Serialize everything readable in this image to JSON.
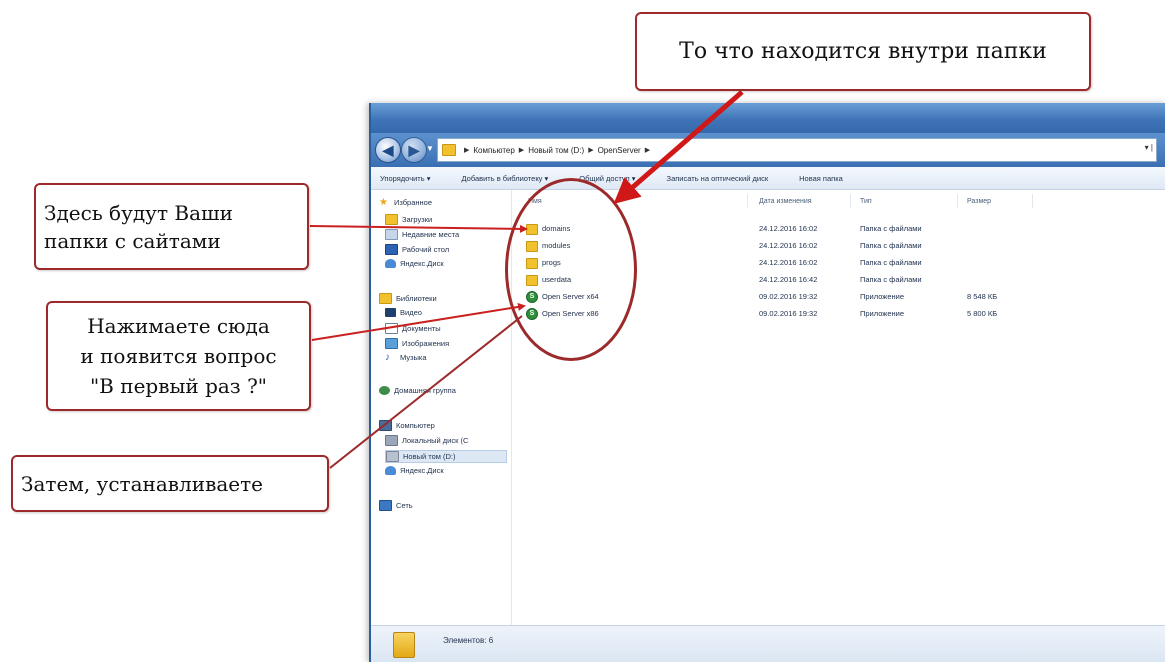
{
  "annotations": {
    "inside_folder": "То что находится внутри папки",
    "your_site_folders": "Здесь будут Ваши\nпапки с сайтами",
    "click_here": "Нажимаете сюда\nи появится вопрос\n\"В первый раз ?\"",
    "then_install": "Затем, устанавливаете"
  },
  "explorer": {
    "breadcrumb": [
      "Компьютер",
      "Новый том (D:)",
      "OpenServer"
    ],
    "toolbar": [
      "Упорядочить ▾",
      "Добавить в библиотеку ▾",
      "Общий доступ ▾",
      "Записать на оптический диск",
      "Новая папка"
    ],
    "nav": {
      "favorites": "Избранное",
      "downloads": "Загрузки",
      "recent": "Недавние места",
      "desktop": "Рабочий стол",
      "yadisk1": "Яндекс.Диск",
      "libraries": "Библиотеки",
      "video": "Видео",
      "documents": "Документы",
      "images": "Изображения",
      "music": "Музыка",
      "homegroup": "Домашняя группа",
      "computer": "Компьютер",
      "local_disk": "Локальный диск (C",
      "new_volume": "Новый том (D:)",
      "yadisk2": "Яндекс.Диск",
      "network": "Сеть"
    },
    "columns": {
      "name": "Имя",
      "date": "Дата изменения",
      "type": "Тип",
      "size": "Размер"
    },
    "rows": [
      {
        "name": "domains",
        "date": "24.12.2016 16:02",
        "type": "Папка с файлами",
        "size": ""
      },
      {
        "name": "modules",
        "date": "24.12.2016 16:02",
        "type": "Папка с файлами",
        "size": ""
      },
      {
        "name": "progs",
        "date": "24.12.2016 16:02",
        "type": "Папка с файлами",
        "size": ""
      },
      {
        "name": "userdata",
        "date": "24.12.2016 16:42",
        "type": "Папка с файлами",
        "size": ""
      },
      {
        "name": "Open Server x64",
        "date": "09.02.2016 19:32",
        "type": "Приложение",
        "size": "8 548 КБ"
      },
      {
        "name": "Open Server x86",
        "date": "09.02.2016 19:32",
        "type": "Приложение",
        "size": "5 800 КБ"
      }
    ],
    "status": "Элементов: 6"
  },
  "colors": {
    "annotation_red": "#9c2a2a",
    "arrow_red": "#c92020",
    "titlebar_blue": "#3f75b8",
    "folder_yellow": "#f2c12e",
    "app_green": "#2f8f3a"
  }
}
